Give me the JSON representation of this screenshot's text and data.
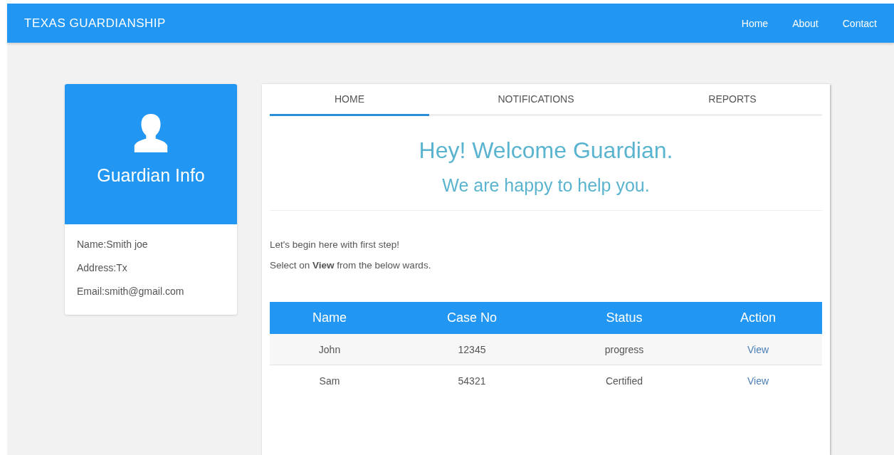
{
  "navbar": {
    "brand": "TEXAS GUARDIANSHIP",
    "links": [
      "Home",
      "About",
      "Contact"
    ]
  },
  "profile_card": {
    "title": "Guardian Info",
    "details": [
      "Name:Smith joe",
      "Address:Tx",
      "Email:smith@gmail.com"
    ]
  },
  "tabs": [
    {
      "label": "HOME",
      "selected": true
    },
    {
      "label": "NOTIFICATIONS",
      "selected": false
    },
    {
      "label": "REPORTS",
      "selected": false
    }
  ],
  "welcome": {
    "heading": "Hey! Welcome Guardian.",
    "subheading": "We are happy to help you."
  },
  "intro": [
    "Let's begin here with first step!",
    "Select on **View** from the below wards."
  ],
  "table": {
    "columns": [
      "Name",
      "Case No",
      "Status",
      "Action"
    ],
    "rows": [
      {
        "name": "John",
        "case_no": "12345",
        "status": "progress",
        "action": "View"
      },
      {
        "name": "Sam",
        "case_no": "54321",
        "status": "Certified",
        "action": "View"
      }
    ]
  }
}
